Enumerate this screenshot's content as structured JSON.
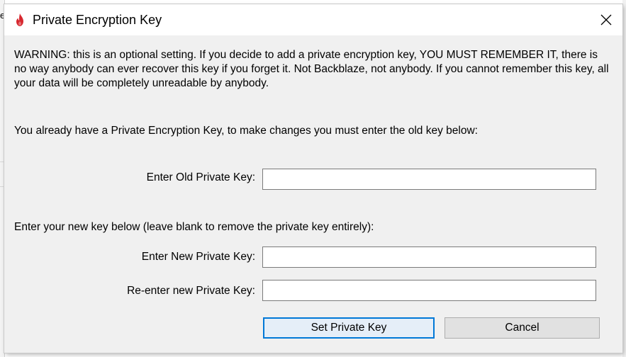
{
  "background": {
    "left_fragment": "e"
  },
  "dialog": {
    "title": "Private Encryption Key",
    "icon": "backblaze-flame-icon",
    "close_icon": "close-icon",
    "warning_text": "WARNING: this is an optional setting.  If you decide to add a private encryption key, YOU MUST REMEMBER IT, there is no way anybody can ever recover this key if you forget it.  Not Backblaze, not anybody.  If you cannot remember this key, all your data will be completely unreadable by anybody.",
    "existing_key_text": "You already have a Private Encryption Key, to make changes you must enter the old key below:",
    "old_key": {
      "label": "Enter Old Private Key:",
      "value": ""
    },
    "new_key_intro": "Enter your new key below (leave blank to remove the private key entirely):",
    "new_key": {
      "label": "Enter New Private Key:",
      "value": ""
    },
    "reenter_key": {
      "label": "Re-enter new Private Key:",
      "value": ""
    },
    "buttons": {
      "set_label": "Set Private Key",
      "cancel_label": "Cancel"
    },
    "colors": {
      "brand_red": "#d7282f",
      "focus_blue": "#0078d7",
      "dialog_bg": "#f0f0f0"
    }
  }
}
